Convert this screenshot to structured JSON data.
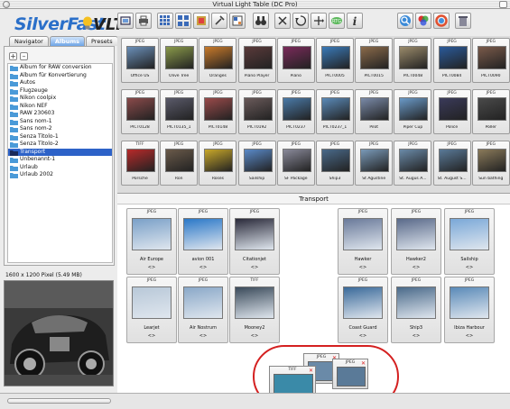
{
  "window": {
    "title": "Virtual Light Table (DC Pro)"
  },
  "logo": {
    "brand": "SilverFast",
    "product": "VLT"
  },
  "tabs": [
    {
      "label": "Navigator",
      "active": false
    },
    {
      "label": "Albums",
      "active": true
    },
    {
      "label": "Presets",
      "active": false
    }
  ],
  "albums": [
    {
      "label": "Album for RAW conversion",
      "selected": false
    },
    {
      "label": "Album für Konvertierung",
      "selected": false
    },
    {
      "label": "Autos",
      "selected": false
    },
    {
      "label": "Flugzeuge",
      "selected": false
    },
    {
      "label": "Nikon coolpix",
      "selected": false
    },
    {
      "label": "Nikon NEF",
      "selected": false
    },
    {
      "label": "RAW 230603",
      "selected": false
    },
    {
      "label": "Sans nom-1",
      "selected": false
    },
    {
      "label": "Sans nom-2",
      "selected": false
    },
    {
      "label": "Senza Titolo-1",
      "selected": false
    },
    {
      "label": "Senza Titolo-2",
      "selected": false
    },
    {
      "label": "Transport",
      "selected": true
    },
    {
      "label": "Unbenannt-1",
      "selected": false
    },
    {
      "label": "Urlaub",
      "selected": false
    },
    {
      "label": "Urlaub 2002",
      "selected": false
    }
  ],
  "preview": {
    "info": "1600 x 1200 Pixel (5.49 MB)"
  },
  "thumbnails": [
    {
      "format": "JPEG",
      "name": "Office US",
      "color": "#6a8fb8"
    },
    {
      "format": "JPEG",
      "name": "Olive Tree",
      "color": "#8a9a4a"
    },
    {
      "format": "JPEG",
      "name": "Oranges",
      "color": "#c87a2a"
    },
    {
      "format": "JPEG",
      "name": "Piano Player",
      "color": "#5a3a3a"
    },
    {
      "format": "JPEG",
      "name": "Piano",
      "color": "#7a2a5a"
    },
    {
      "format": "JPEG",
      "name": "PICT0005",
      "color": "#3a7ab8"
    },
    {
      "format": "JPEG",
      "name": "PICT0015",
      "color": "#8a6a4a"
    },
    {
      "format": "JPEG",
      "name": "PICT0048",
      "color": "#9a8a6a"
    },
    {
      "format": "JPEG",
      "name": "PICT0084",
      "color": "#2a5a9a"
    },
    {
      "format": "JPEG",
      "name": "PICT0090",
      "color": "#7a5a4a"
    },
    {
      "format": "JPEG",
      "name": "PICT0128",
      "color": "#8a4a4a"
    },
    {
      "format": "JPEG",
      "name": "PICT0135_1",
      "color": "#5a5a6a"
    },
    {
      "format": "JPEG",
      "name": "PICT0148",
      "color": "#9a4a4a"
    },
    {
      "format": "JPEG",
      "name": "PICT0192",
      "color": "#6a5a5a"
    },
    {
      "format": "JPEG",
      "name": "PICT0237",
      "color": "#4a7aa8"
    },
    {
      "format": "JPEG",
      "name": "PICT0237_1",
      "color": "#5a8ab8"
    },
    {
      "format": "JPEG",
      "name": "Pilot",
      "color": "#7a8aa8"
    },
    {
      "format": "JPEG",
      "name": "Piper Cup",
      "color": "#6a9ac8"
    },
    {
      "format": "JPEG",
      "name": "Police",
      "color": "#3a3a5a"
    },
    {
      "format": "JPEG",
      "name": "Poller",
      "color": "#4a4a4a"
    },
    {
      "format": "TIFF",
      "name": "Porsche",
      "color": "#b82a2a"
    },
    {
      "format": "JPEG",
      "name": "Ron",
      "color": "#6a5a4a"
    },
    {
      "format": "JPEG",
      "name": "Roses",
      "color": "#c8a82a"
    },
    {
      "format": "JPEG",
      "name": "Sailship",
      "color": "#5a8ac8"
    },
    {
      "format": "JPEG",
      "name": "SF Package",
      "color": "#8a8a9a"
    },
    {
      "format": "JPEG",
      "name": "Ship3",
      "color": "#4a6a8a"
    },
    {
      "format": "JPEG",
      "name": "St Agustine",
      "color": "#7a9ab8"
    },
    {
      "format": "JPEG",
      "name": "St. Augus A...",
      "color": "#6a8aa8"
    },
    {
      "format": "JPEG",
      "name": "St. August S...",
      "color": "#5a7a98"
    },
    {
      "format": "JPEG",
      "name": "Sun bathing",
      "color": "#8a7a5a"
    }
  ],
  "transport": {
    "title": "Transport",
    "items": [
      {
        "format": "JPEG",
        "name": "Air Europe",
        "arrows": "<>",
        "color": "#7aa0c8"
      },
      {
        "format": "JPEG",
        "name": "avion 001",
        "arrows": "<>",
        "color": "#2a78c8"
      },
      {
        "format": "JPEG",
        "name": "Citationjet",
        "arrows": "<>",
        "color": "#2a2a3a"
      },
      {
        "format": "JPEG",
        "name": "Hawker",
        "arrows": "<>",
        "color": "#6a7a9a"
      },
      {
        "format": "JPEG",
        "name": "Hawker2",
        "arrows": "<>",
        "color": "#5a6a8a"
      },
      {
        "format": "JPEG",
        "name": "Sailship",
        "arrows": "<>",
        "color": "#7aa8d8"
      },
      {
        "format": "JPEG",
        "name": "Learjet",
        "arrows": "<>",
        "color": "#b8c8d8"
      },
      {
        "format": "JPEG",
        "name": "Air Nostrum",
        "arrows": "<>",
        "color": "#8aa8c8"
      },
      {
        "format": "TIFF",
        "name": "Mooney2",
        "arrows": "<>",
        "color": "#3a4a5a"
      },
      {
        "format": "JPEG",
        "name": "Coast Guard",
        "arrows": "<>",
        "color": "#3a6a9a"
      },
      {
        "format": "JPEG",
        "name": "Ship3",
        "arrows": "<>",
        "color": "#4a6a8a"
      },
      {
        "format": "JPEG",
        "name": "Ibiza Harbour",
        "arrows": "<>",
        "color": "#5a8ab8"
      }
    ]
  },
  "drag": [
    {
      "format": "JPEG"
    },
    {
      "format": "JPEG"
    },
    {
      "format": "TIFF"
    }
  ],
  "icons": [
    "scan-icon",
    "print-icon",
    "grid-icon",
    "grid-large-icon",
    "album-icon",
    "tools-icon",
    "layout-icon",
    "binoculars-icon",
    "delete-icon",
    "rotate-icon",
    "flip-icon",
    "rgb-icon",
    "info-icon",
    "zoom-icon",
    "color-icon",
    "trash-icon"
  ]
}
